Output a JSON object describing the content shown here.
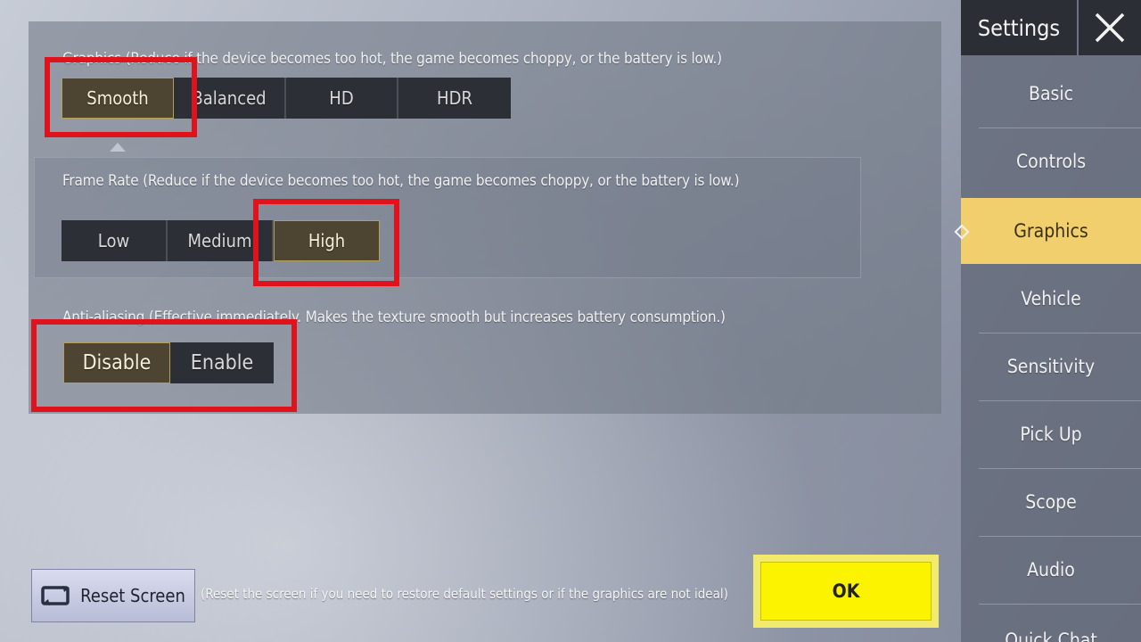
{
  "graphics": {
    "label": "Graphics (Reduce if the device becomes too hot, the game becomes choppy, or the battery is low.)",
    "options": [
      "Smooth",
      "Balanced",
      "HD",
      "HDR"
    ],
    "selected": "Smooth"
  },
  "frame_rate": {
    "label": "Frame Rate (Reduce if the device becomes too hot, the game becomes choppy, or the battery is low.)",
    "options": [
      "Low",
      "Medium",
      "High"
    ],
    "selected": "High"
  },
  "anti_aliasing": {
    "label": "Anti-aliasing (Effective immediately. Makes the texture smooth but increases battery consumption.)",
    "options": [
      "Disable",
      "Enable"
    ],
    "selected": "Disable"
  },
  "sidebar": {
    "title": "Settings",
    "items": [
      {
        "label": "Basic"
      },
      {
        "label": "Controls"
      },
      {
        "label": "Graphics"
      },
      {
        "label": "Vehicle"
      },
      {
        "label": "Sensitivity"
      },
      {
        "label": "Pick Up"
      },
      {
        "label": "Scope"
      },
      {
        "label": "Audio"
      },
      {
        "label": "Quick Chat"
      }
    ],
    "active": "Graphics"
  },
  "footer": {
    "reset_label": "Reset Screen",
    "reset_note": "(Reset the screen if you need to restore default settings or if the graphics are not ideal)",
    "ok_label": "OK"
  },
  "colors": {
    "highlight": "#e0131c",
    "accent_gold": "#f0cf6c",
    "ok_yellow": "#fbf300"
  }
}
